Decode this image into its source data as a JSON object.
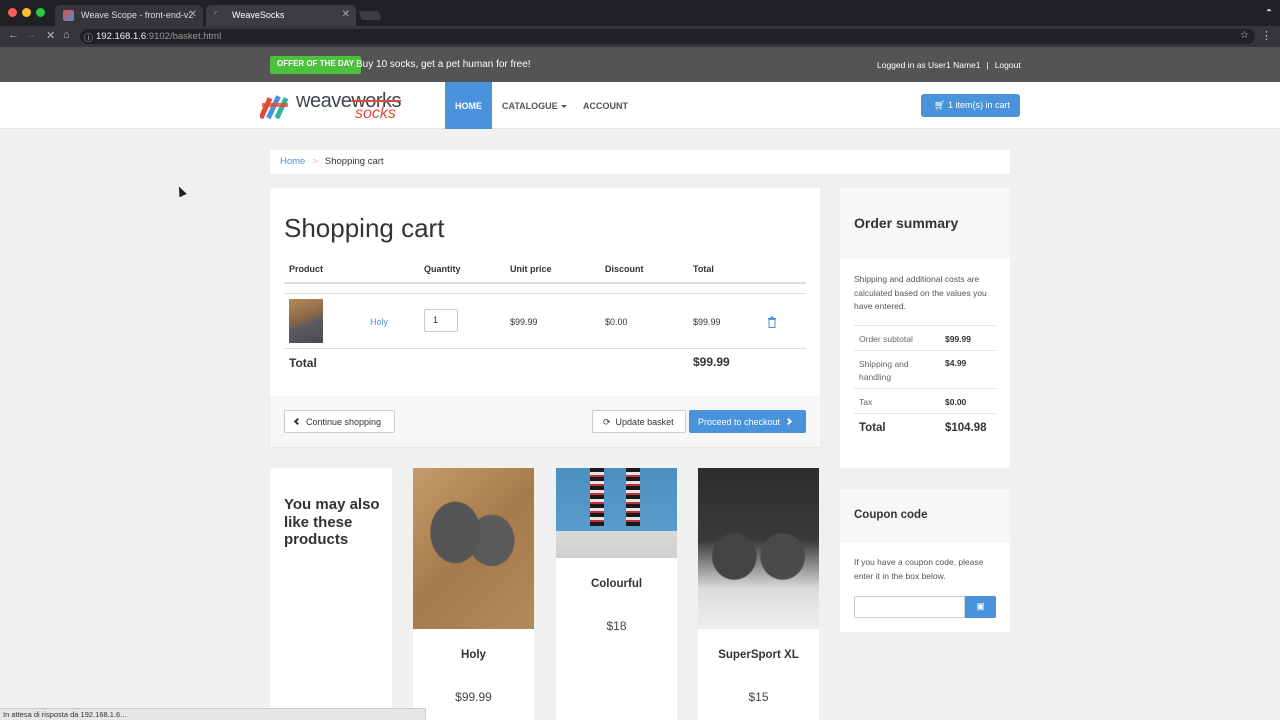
{
  "browser": {
    "tabs": [
      {
        "title": "Weave Scope - front-end-v2",
        "active": false
      },
      {
        "title": "WeaveSocks",
        "active": true
      }
    ],
    "url_host": "192.168.1.6",
    "url_path": ":9102/basket.html",
    "status_text": "In attesa di risposta da 192.168.1.6..."
  },
  "topbar": {
    "offer_badge": "OFFER OF THE DAY",
    "offer_text": "Buy 10 socks, get a pet human for free!",
    "logged_in": "Logged in as User1 Name1",
    "separator": "|",
    "logout": "Logout"
  },
  "logo": {
    "weave": "weave",
    "works": "works",
    "socks": "socks"
  },
  "nav": {
    "home": "HOME",
    "catalogue": "CATALOGUE",
    "account": "ACCOUNT",
    "cart_button": "1 item(s) in cart"
  },
  "breadcrumb": {
    "home": "Home",
    "separator": ">",
    "current": "Shopping cart"
  },
  "cart": {
    "title": "Shopping cart",
    "columns": [
      "Product",
      "Quantity",
      "Unit price",
      "Discount",
      "Total"
    ],
    "items": [
      {
        "name": "Holy",
        "quantity": "1",
        "unit_price": "$99.99",
        "discount": "$0.00",
        "total": "$99.99"
      }
    ],
    "total_label": "Total",
    "total_value": "$99.99",
    "continue_button": "Continue shopping",
    "update_button": "Update basket",
    "checkout_button": "Proceed to checkout"
  },
  "summary": {
    "title": "Order summary",
    "note": "Shipping and additional costs are calculated based on the values you have entered.",
    "rows": [
      {
        "label": "Order subtotal",
        "value": "$99.99"
      },
      {
        "label": "Shipping and handling",
        "value": "$4.99"
      },
      {
        "label": "Tax",
        "value": "$0.00"
      },
      {
        "label": "Total",
        "value": "$104.98"
      }
    ]
  },
  "coupon": {
    "title": "Coupon code",
    "note": "If you have a coupon code, please enter it in the box below.",
    "input_value": ""
  },
  "suggestions": {
    "title": "You may also like these products",
    "products": [
      {
        "name": "Holy",
        "price": "$99.99"
      },
      {
        "name": "Colourful",
        "price": "$18"
      },
      {
        "name": "SuperSport XL",
        "price": "$15"
      }
    ]
  },
  "colors": {
    "accent": "#4993dd",
    "offer": "#4fbf40",
    "brand_red": "#e24a37",
    "topbar": "#545454"
  }
}
